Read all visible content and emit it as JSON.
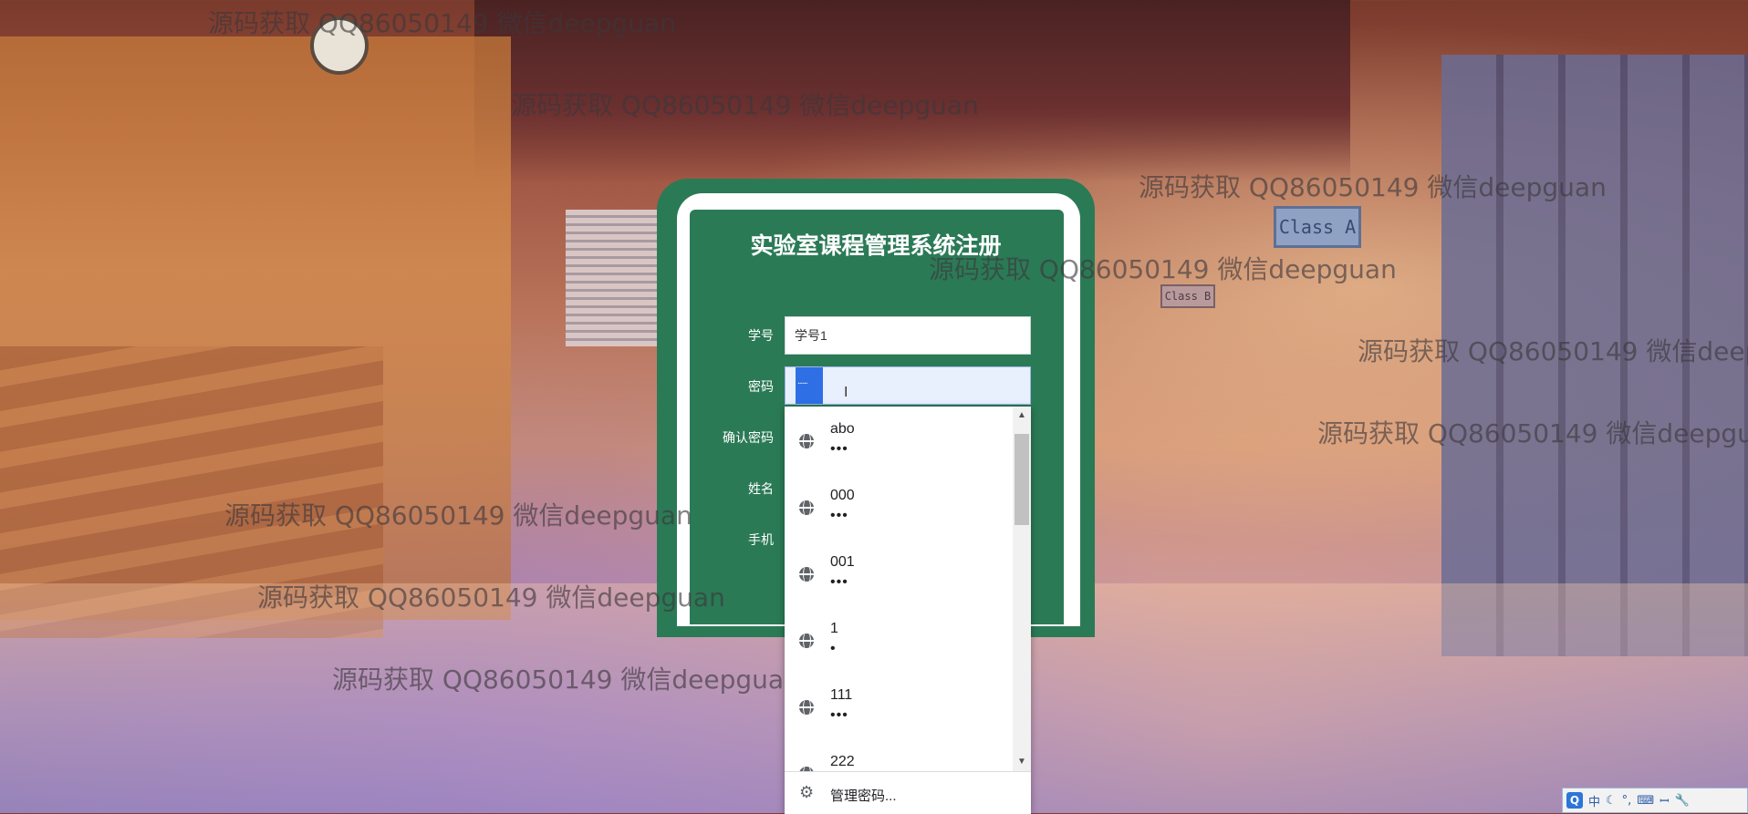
{
  "watermark_text": "源码获取 QQ86050149 微信deepguan",
  "watermarks": [
    {
      "text": "源码获取 QQ86050149 微信deepguan"
    },
    {
      "text": "源码获取 QQ86050149 微信deepguan"
    },
    {
      "text": "源码获取 QQ86050149 微信deepguan"
    },
    {
      "text": "源码获取 QQ86050149 微信deepguan"
    },
    {
      "text": "源码获取 QQ86050149 微信deepguan"
    },
    {
      "text": "源码获取 QQ86050149 微信deepguan"
    },
    {
      "text": "源码获取 QQ86050149 微信deepguan"
    },
    {
      "text": "源码获取 QQ86050149 微信deepguan"
    },
    {
      "text": "源码获取 QQ86050149 微信deepguan"
    }
  ],
  "background": {
    "sign_text": "Class A",
    "sign_text_small": "Class B"
  },
  "form": {
    "title": "实验室课程管理系统注册",
    "fields": {
      "student_id": {
        "label": "学号",
        "value": "学号1"
      },
      "password": {
        "label": "密码",
        "value": "......"
      },
      "confirm_password": {
        "label": "确认密码"
      },
      "name": {
        "label": "姓名"
      },
      "phone": {
        "label": "手机"
      }
    }
  },
  "autofill": {
    "items": [
      {
        "username": "abo",
        "password": "•••"
      },
      {
        "username": "000",
        "password": "•••"
      },
      {
        "username": "001",
        "password": "•••"
      },
      {
        "username": "1",
        "password": "•"
      },
      {
        "username": "111",
        "password": "•••"
      },
      {
        "username": "222",
        "password": "•••"
      }
    ],
    "manage_label": "管理密码..."
  },
  "ime": {
    "logo": "Q",
    "mode": "中",
    "moon": "☾",
    "punct": "°,",
    "keyboard": "⌨",
    "extra": "ꟷ",
    "tools": "🔧"
  },
  "colors": {
    "form_green": "#2b7a56",
    "focus_fill": "#e8f0fe",
    "selection_blue": "#2f6fe6"
  }
}
